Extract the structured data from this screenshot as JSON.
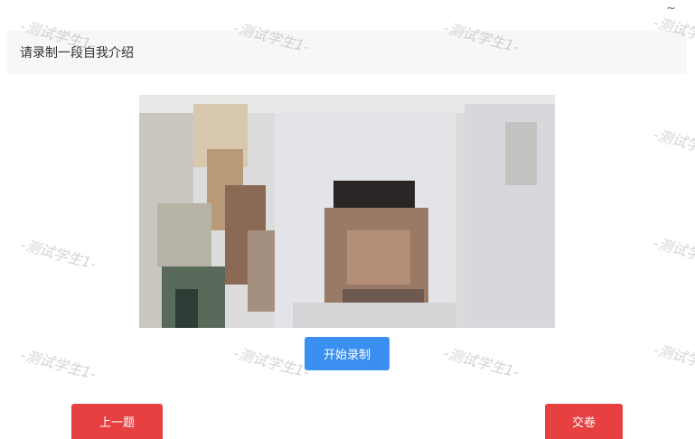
{
  "header": {
    "corner_glyph": "~"
  },
  "question": {
    "prompt": "请录制一段自我介绍"
  },
  "video": {
    "icon": "camera-preview"
  },
  "controls": {
    "record_label": "开始录制",
    "prev_label": "上一题",
    "submit_label": "交卷"
  },
  "colors": {
    "accent_blue": "#3b8ff0",
    "danger_red": "#e64040",
    "question_bg": "#f6f7f9"
  },
  "watermark": {
    "text": "-测试学生1-"
  }
}
